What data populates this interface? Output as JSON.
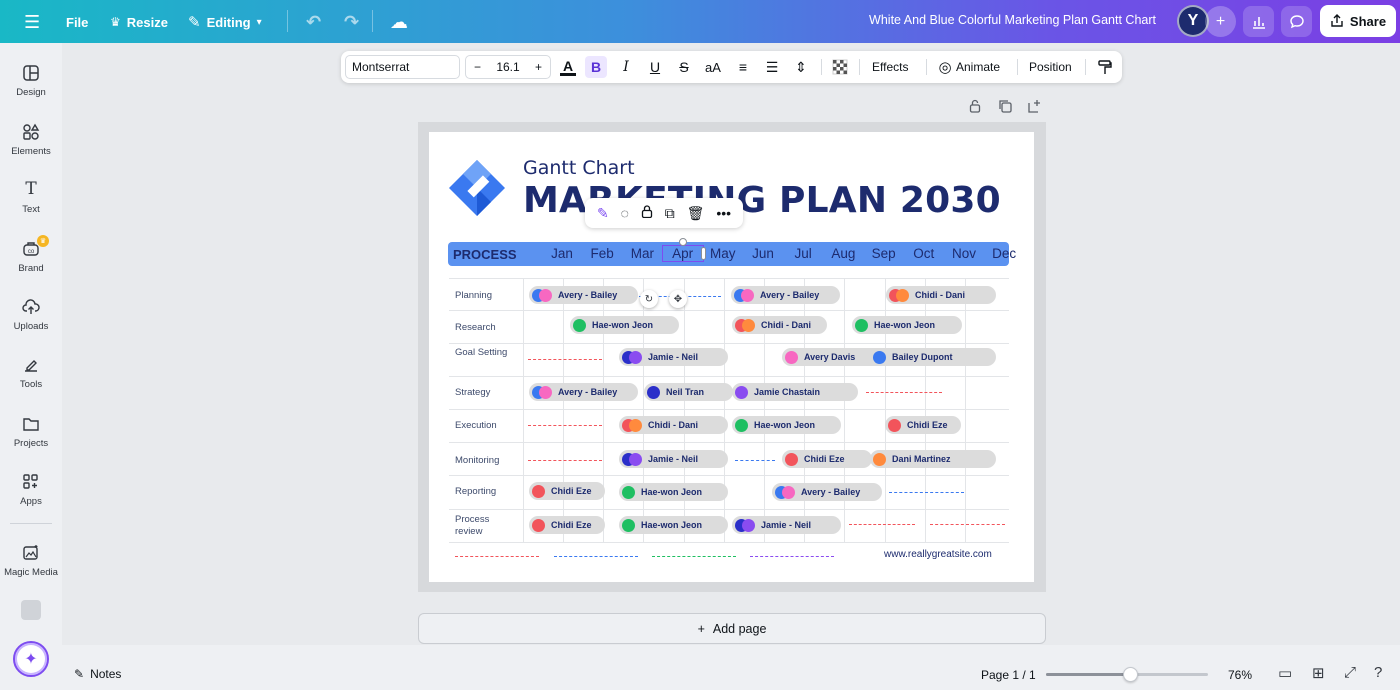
{
  "topbar": {
    "menu_icon": "hamburger-icon",
    "file_label": "File",
    "resize_label": "Resize",
    "editing_label": "Editing",
    "doc_title": "White And Blue Colorful Marketing Plan Gantt Chart",
    "avatar_initial": "Y",
    "share_label": "Share"
  },
  "sidebar": {
    "items": [
      {
        "label": "Design",
        "icon": "design-icon"
      },
      {
        "label": "Elements",
        "icon": "elements-icon"
      },
      {
        "label": "Text",
        "icon": "text-icon"
      },
      {
        "label": "Brand",
        "icon": "brand-icon"
      },
      {
        "label": "Uploads",
        "icon": "uploads-icon"
      },
      {
        "label": "Tools",
        "icon": "tools-icon"
      },
      {
        "label": "Projects",
        "icon": "projects-icon"
      },
      {
        "label": "Apps",
        "icon": "apps-icon"
      },
      {
        "label": "Magic Media",
        "icon": "magic-media-icon"
      }
    ]
  },
  "textbar": {
    "font": "Montserrat",
    "size": "16.1",
    "effects_label": "Effects",
    "animate_label": "Animate",
    "position_label": "Position"
  },
  "chart": {
    "subtitle": "Gantt Chart",
    "title": "MARKETING PLAN 2030",
    "process_label": "PROCESS",
    "months": [
      "Jan",
      "Feb",
      "Mar",
      "Apr",
      "May",
      "Jun",
      "Jul",
      "Aug",
      "Sep",
      "Oct",
      "Nov",
      "Dec"
    ],
    "selected_month": "Apr",
    "rows": [
      "Planning",
      "Research",
      "Goal Setting",
      "Strategy",
      "Execution",
      "Monitoring",
      "Reporting",
      "Process review"
    ],
    "website": "www.reallygreatsite.com",
    "colors": {
      "pink": "#f768c1",
      "blue": "#3a79f0",
      "orange": "#ff8a3d",
      "red": "#f2545b",
      "green": "#1fbf62",
      "navy": "#2b2fc9",
      "purple": "#8a4cf0"
    },
    "tasks": [
      {
        "row": 0,
        "label": "Avery - Bailey",
        "dots": [
          "blue",
          "pink"
        ]
      },
      {
        "row": 0,
        "label": "Avery - Bailey",
        "dots": [
          "blue",
          "pink"
        ]
      },
      {
        "row": 0,
        "label": "Chidi - Dani",
        "dots": [
          "red",
          "orange"
        ]
      },
      {
        "row": 1,
        "label": "Hae-won Jeon",
        "dots": [
          "green"
        ]
      },
      {
        "row": 1,
        "label": "Chidi - Dani",
        "dots": [
          "red",
          "orange"
        ]
      },
      {
        "row": 1,
        "label": "Hae-won Jeon",
        "dots": [
          "green"
        ]
      },
      {
        "row": 2,
        "label": "Jamie - Neil",
        "dots": [
          "navy",
          "purple"
        ]
      },
      {
        "row": 2,
        "label": "Avery Davis",
        "dots": [
          "pink"
        ]
      },
      {
        "row": 2,
        "label": "Bailey Dupont",
        "dots": [
          "blue"
        ]
      },
      {
        "row": 3,
        "label": "Avery - Bailey",
        "dots": [
          "blue",
          "pink"
        ]
      },
      {
        "row": 3,
        "label": "Neil Tran",
        "dots": [
          "navy"
        ]
      },
      {
        "row": 3,
        "label": "Jamie Chastain",
        "dots": [
          "purple"
        ]
      },
      {
        "row": 4,
        "label": "Chidi - Dani",
        "dots": [
          "red",
          "orange"
        ]
      },
      {
        "row": 4,
        "label": "Hae-won Jeon",
        "dots": [
          "green"
        ]
      },
      {
        "row": 4,
        "label": "Chidi Eze",
        "dots": [
          "red"
        ]
      },
      {
        "row": 5,
        "label": "Jamie - Neil",
        "dots": [
          "navy",
          "purple"
        ]
      },
      {
        "row": 5,
        "label": "Chidi Eze",
        "dots": [
          "red"
        ]
      },
      {
        "row": 5,
        "label": "Dani Martinez",
        "dots": [
          "orange"
        ]
      },
      {
        "row": 6,
        "label": "Chidi Eze",
        "dots": [
          "red"
        ]
      },
      {
        "row": 6,
        "label": "Hae-won Jeon",
        "dots": [
          "green"
        ]
      },
      {
        "row": 6,
        "label": "Avery - Bailey",
        "dots": [
          "blue",
          "pink"
        ]
      },
      {
        "row": 7,
        "label": "Chidi Eze",
        "dots": [
          "red"
        ]
      },
      {
        "row": 7,
        "label": "Hae-won Jeon",
        "dots": [
          "green"
        ]
      },
      {
        "row": 7,
        "label": "Jamie - Neil",
        "dots": [
          "navy",
          "purple"
        ]
      }
    ]
  },
  "canvas": {
    "add_page_label": "Add page"
  },
  "bottombar": {
    "notes_label": "Notes",
    "page_count": "Page 1 / 1",
    "zoom": "76%",
    "zoom_fraction": 0.52
  }
}
